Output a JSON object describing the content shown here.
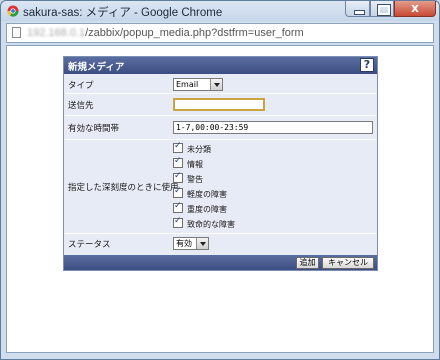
{
  "window": {
    "title": "sakura-sas: メディア - Google Chrome",
    "close_glyph": "x"
  },
  "address": {
    "host_blurred": "192.168.0.1",
    "path": "/zabbix/popup_media.php?dstfrm=user_form"
  },
  "form": {
    "title": "新規メディア",
    "help_glyph": "?",
    "type_label": "タイプ",
    "type_value": "Email",
    "sendto_label": "送信先",
    "sendto_value": "",
    "period_label": "有効な時間帯",
    "period_value": "1-7,00:00-23:59",
    "severity_label": "指定した深刻度のときに使用",
    "severities": [
      "未分類",
      "情報",
      "警告",
      "軽度の障害",
      "重度の障害",
      "致命的な障害"
    ],
    "status_label": "ステータス",
    "status_value": "有効",
    "add_button": "追加",
    "cancel_button": "キャンセル"
  },
  "icons": {
    "app": "chrome-icon",
    "page": "page-icon",
    "help": "help-icon"
  }
}
